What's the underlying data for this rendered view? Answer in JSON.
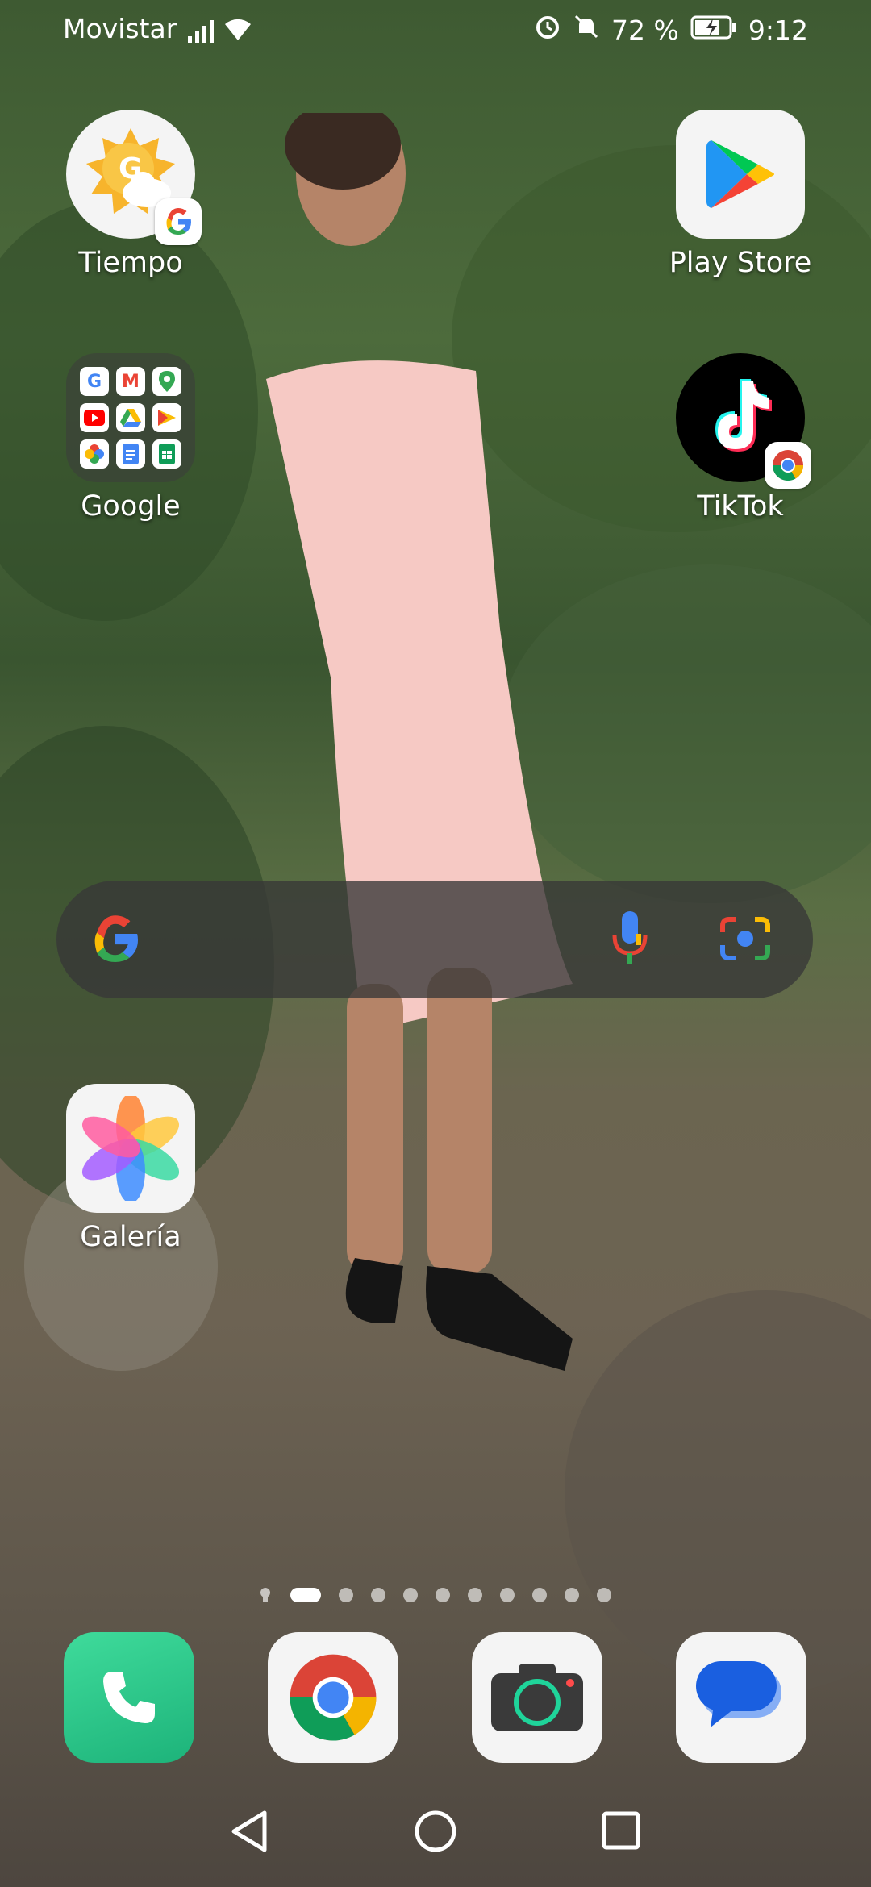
{
  "status_bar": {
    "carrier": "Movistar",
    "battery_percent": "72 %",
    "time": "9:12",
    "icons": [
      "signal-icon",
      "wifi-icon",
      "alarm-icon",
      "mute-icon",
      "battery-charging-icon"
    ]
  },
  "home": {
    "apps": [
      {
        "label": "Tiempo",
        "icon": "weather-icon"
      },
      {
        "label": "Play Store",
        "icon": "play-store-icon"
      },
      {
        "label": "Google",
        "icon": "google-folder-icon"
      },
      {
        "label": "TikTok",
        "icon": "tiktok-icon"
      },
      {
        "label": "Galería",
        "icon": "gallery-icon"
      }
    ],
    "search_widget": {
      "icons": [
        "google-g-icon",
        "microphone-icon",
        "lens-camera-icon"
      ]
    },
    "pages": {
      "count": 10,
      "current": 1
    }
  },
  "dock": {
    "apps": [
      {
        "name": "Teléfono",
        "icon": "phone-icon"
      },
      {
        "name": "Chrome",
        "icon": "chrome-icon"
      },
      {
        "name": "Cámara",
        "icon": "camera-icon"
      },
      {
        "name": "Mensajes",
        "icon": "messages-icon"
      }
    ]
  },
  "navigation": {
    "buttons": [
      "back-icon",
      "home-icon",
      "recents-icon"
    ]
  }
}
